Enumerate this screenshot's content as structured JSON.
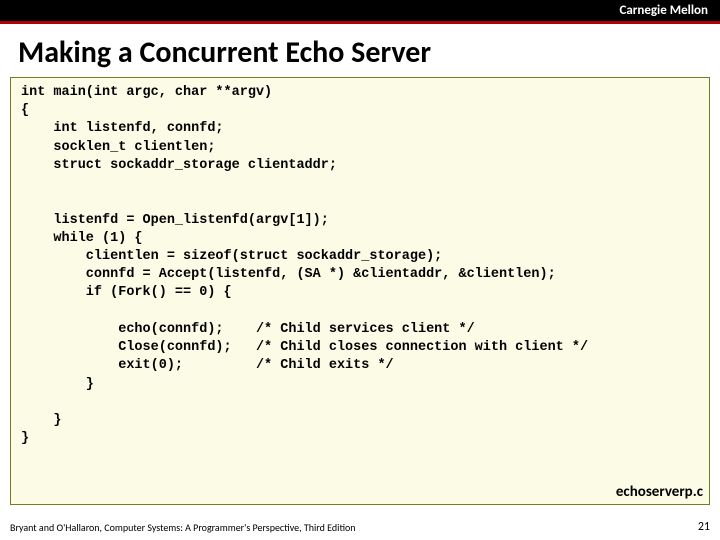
{
  "header": {
    "institution": "Carnegie Mellon"
  },
  "title": "Making a Concurrent Echo Server",
  "code": "int main(int argc, char **argv)\n{\n    int listenfd, connfd;\n    socklen_t clientlen;\n    struct sockaddr_storage clientaddr;\n\n\n    listenfd = Open_listenfd(argv[1]);\n    while (1) {\n        clientlen = sizeof(struct sockaddr_storage);\n        connfd = Accept(listenfd, (SA *) &clientaddr, &clientlen);\n        if (Fork() == 0) {\n\n            echo(connfd);    /* Child services client */\n            Close(connfd);   /* Child closes connection with client */\n            exit(0);         /* Child exits */\n        }\n\n    }\n}",
  "filename": "echoserverp.c",
  "footer": {
    "credit": "Bryant and O'Hallaron, Computer Systems: A Programmer's Perspective, Third Edition",
    "page": "21"
  }
}
